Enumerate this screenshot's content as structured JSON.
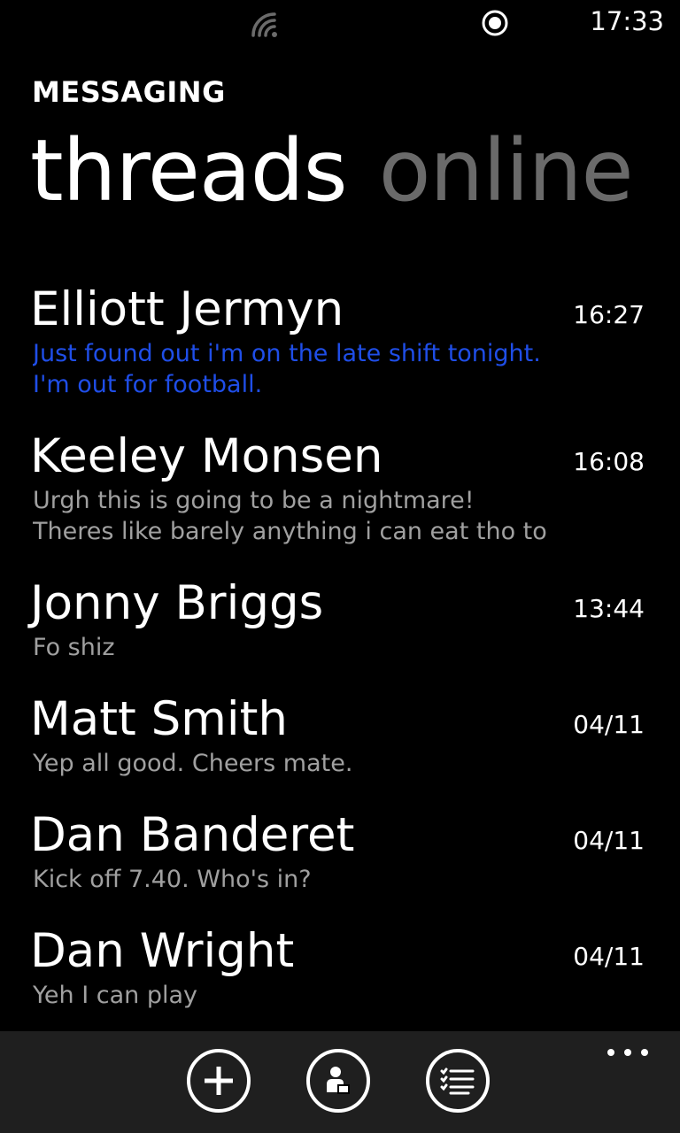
{
  "status_bar": {
    "time": "17:33",
    "icons": [
      "signal-icon",
      "record-icon"
    ]
  },
  "app_title": "MESSAGING",
  "pivot": {
    "active": "threads",
    "inactive": "online"
  },
  "threads": [
    {
      "name": "Elliott Jermyn",
      "time": "16:27",
      "preview": [
        "Just found out i'm on the late shift tonight.",
        "I'm out for football."
      ],
      "unread": true
    },
    {
      "name": "Keeley Monsen",
      "time": "16:08",
      "preview": [
        "Urgh this is going to be a nightmare!",
        "Theres like barely anything i can eat tho to"
      ],
      "unread": false
    },
    {
      "name": "Jonny Briggs",
      "time": "13:44",
      "preview": [
        "Fo shiz"
      ],
      "unread": false
    },
    {
      "name": "Matt Smith",
      "time": "04/11",
      "preview": [
        "Yep all good. Cheers mate."
      ],
      "unread": false
    },
    {
      "name": "Dan Banderet",
      "time": "04/11",
      "preview": [
        "Kick off 7.40. Who's in?"
      ],
      "unread": false
    },
    {
      "name": "Dan Wright",
      "time": "04/11",
      "preview": [
        "Yeh I can play"
      ],
      "unread": false
    }
  ],
  "app_bar": {
    "buttons": [
      "new-icon",
      "contact-icon",
      "select-icon"
    ],
    "more": "more-dots-icon"
  },
  "colors": {
    "background": "#000000",
    "accent": "#1f4ee8",
    "secondary_text": "#a0a0a0",
    "inactive_pivot": "#6a6a6a",
    "app_bar": "#1f1f1f"
  }
}
